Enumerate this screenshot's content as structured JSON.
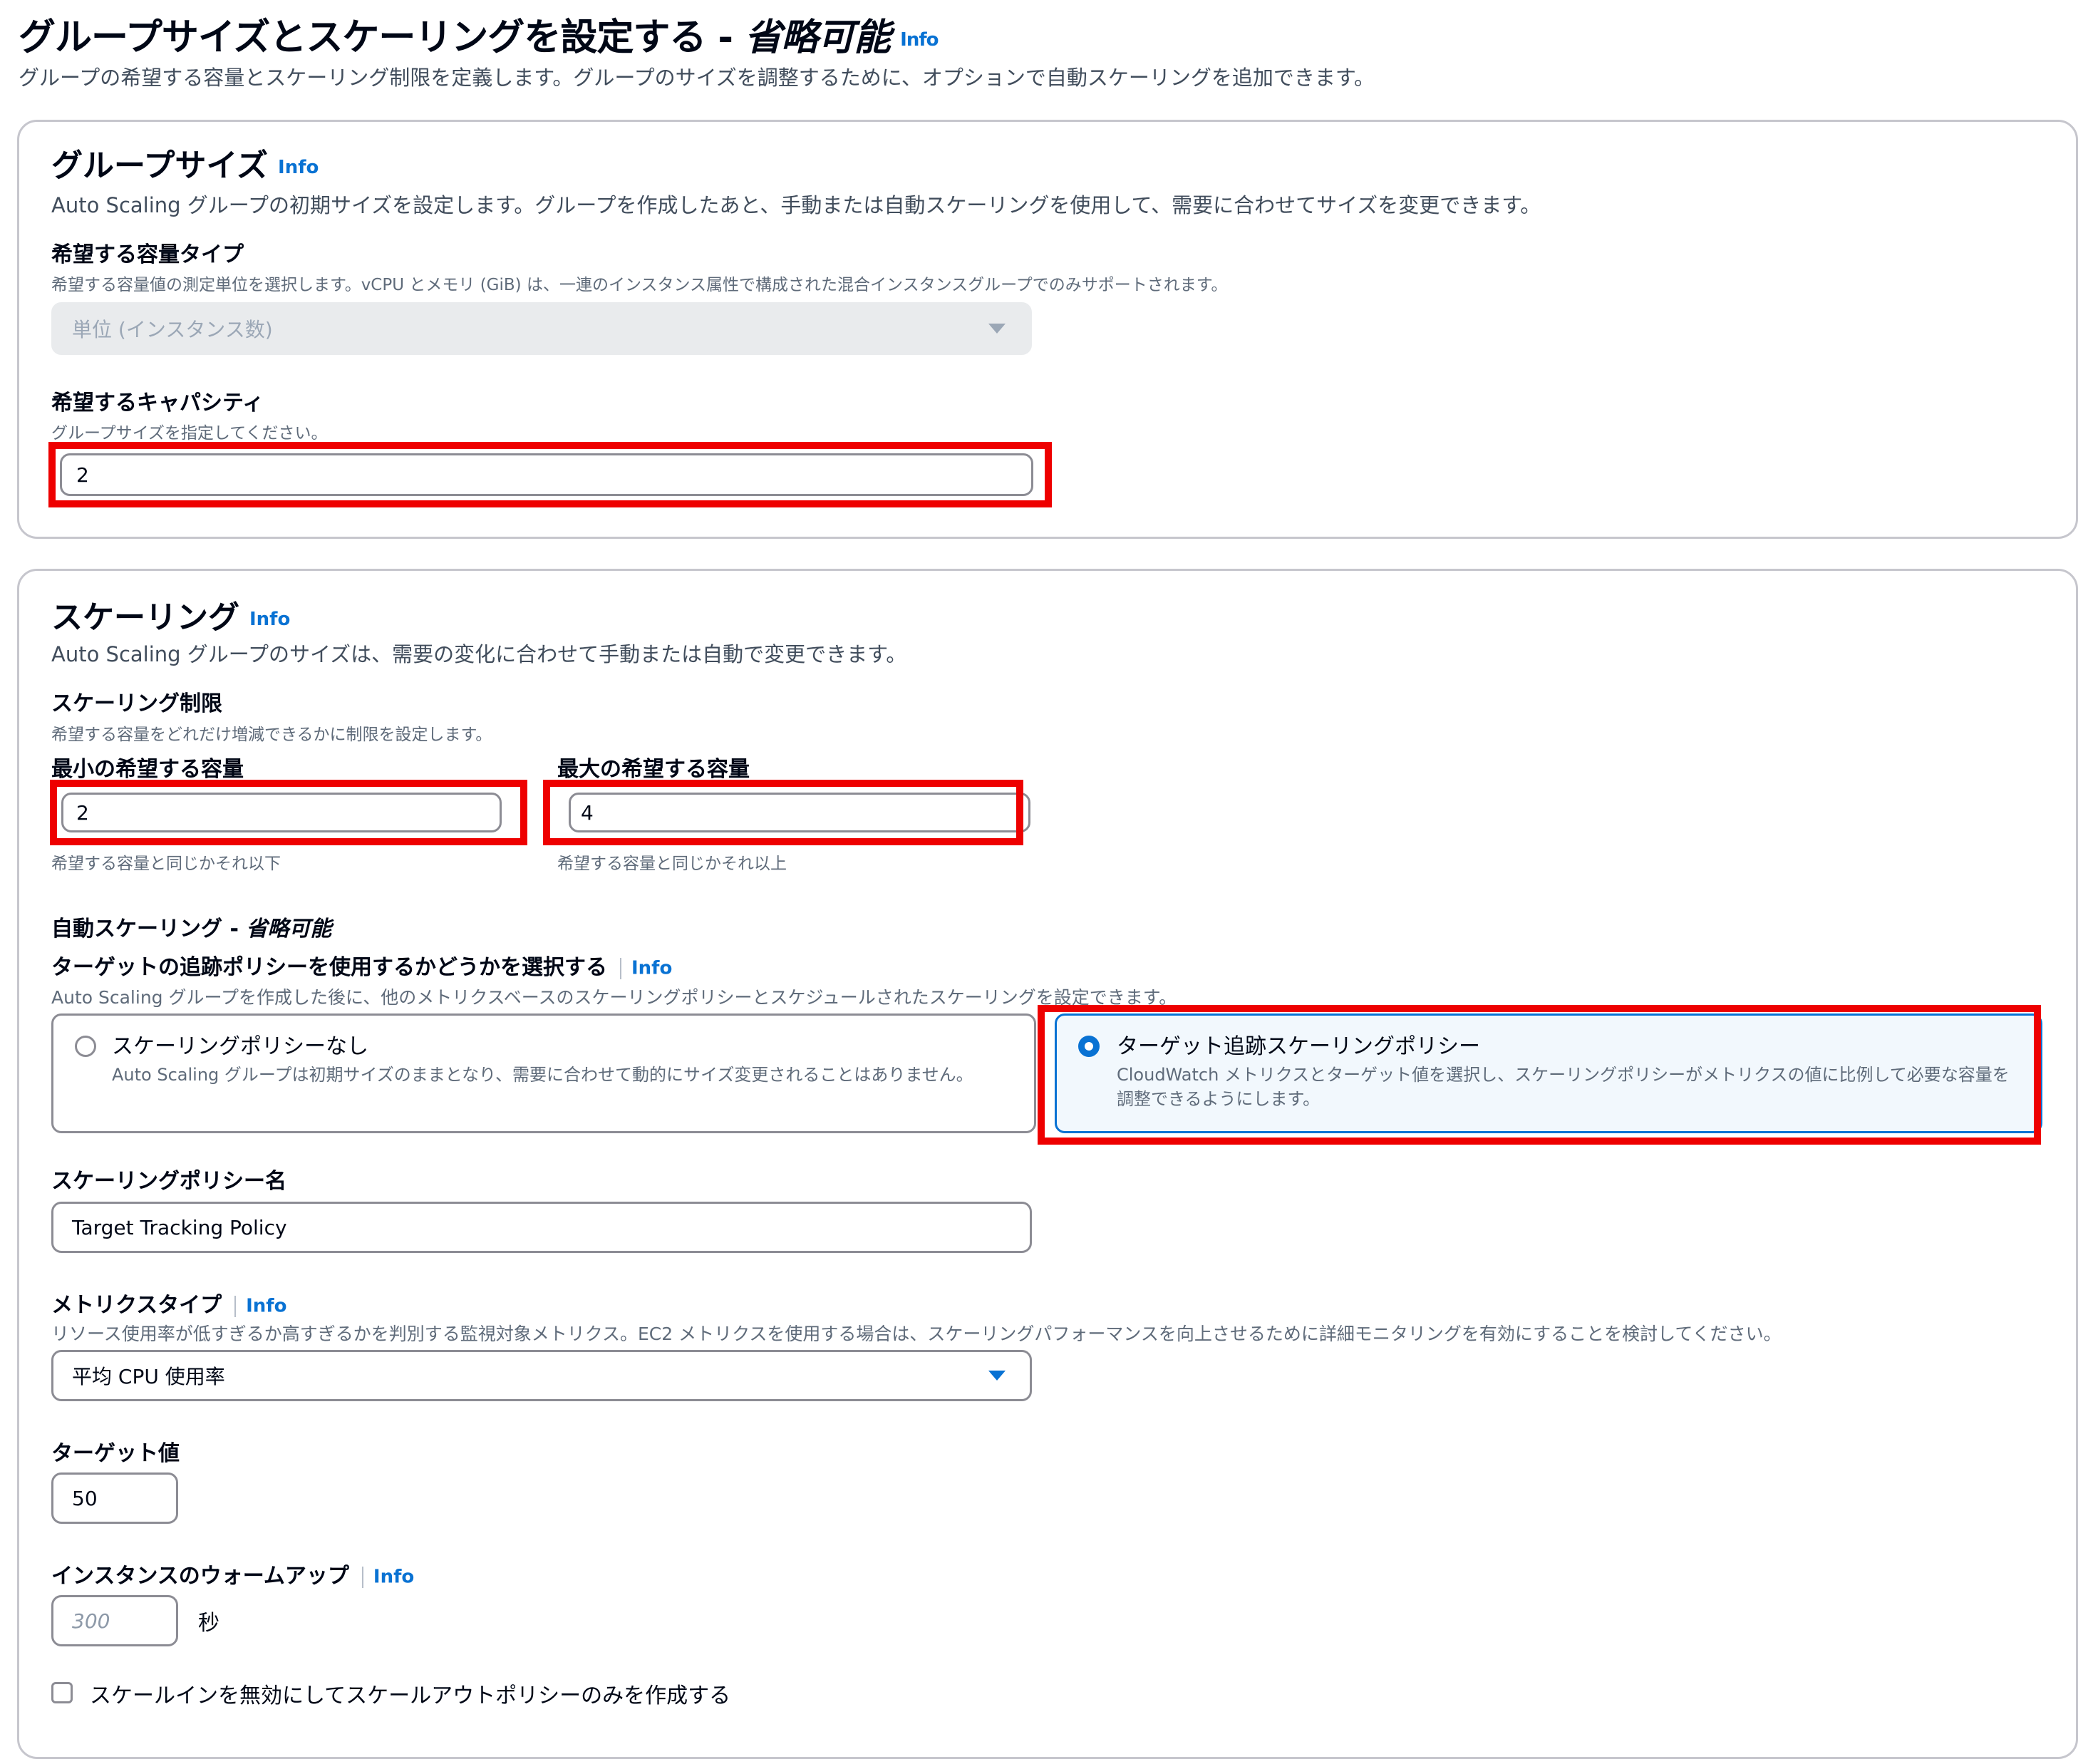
{
  "header": {
    "title": "グループサイズとスケーリングを設定する - ",
    "title_optional": "省略可能",
    "info": "Info",
    "description": "グループの希望する容量とスケーリング制限を定義します。グループのサイズを調整するために、オプションで自動スケーリングを追加できます。"
  },
  "group_size": {
    "heading": "グループサイズ",
    "info": "Info",
    "description": "Auto Scaling グループの初期サイズを設定します。グループを作成したあと、手動または自動スケーリングを使用して、需要に合わせてサイズを変更できます。",
    "capacity_type": {
      "label": "希望する容量タイプ",
      "description": "希望する容量値の測定単位を選択します。vCPU とメモリ (GiB) は、一連のインスタンス属性で構成された混合インスタンスグループでのみサポートされます。",
      "value": "単位 (インスタンス数)"
    },
    "desired_capacity": {
      "label": "希望するキャパシティ",
      "description": "グループサイズを指定してください。",
      "value": "2"
    }
  },
  "scaling": {
    "heading": "スケーリング",
    "info": "Info",
    "description": "Auto Scaling グループのサイズは、需要の変化に合わせて手動または自動で変更できます。",
    "limits": {
      "label": "スケーリング制限",
      "description": "希望する容量をどれだけ増減できるかに制限を設定します。",
      "min": {
        "label": "最小の希望する容量",
        "value": "2",
        "hint": "希望する容量と同じかそれ以下"
      },
      "max": {
        "label": "最大の希望する容量",
        "value": "4",
        "hint": "希望する容量と同じかそれ以上"
      }
    },
    "auto": {
      "label": "自動スケーリング - ",
      "label_optional": "省略可能",
      "question": "ターゲットの追跡ポリシーを使用するかどうかを選択する",
      "info": "Info",
      "description": "Auto Scaling グループを作成した後に、他のメトリクスベースのスケーリングポリシーとスケジュールされたスケーリングを設定できます。",
      "options": [
        {
          "title": "スケーリングポリシーなし",
          "description": "Auto Scaling グループは初期サイズのままとなり、需要に合わせて動的にサイズ変更されることはありません。",
          "selected": false
        },
        {
          "title": "ターゲット追跡スケーリングポリシー",
          "description": "CloudWatch メトリクスとターゲット値を選択し、スケーリングポリシーがメトリクスの値に比例して必要な容量を調整できるようにします。",
          "selected": true
        }
      ]
    },
    "policy_name": {
      "label": "スケーリングポリシー名",
      "value": "Target Tracking Policy"
    },
    "metric_type": {
      "label": "メトリクスタイプ",
      "info": "Info",
      "description": "リソース使用率が低すぎるか高すぎるかを判別する監視対象メトリクス。EC2 メトリクスを使用する場合は、スケーリングパフォーマンスを向上させるために詳細モニタリングを有効にすることを検討してください。",
      "value": "平均 CPU 使用率"
    },
    "target_value": {
      "label": "ターゲット値",
      "value": "50"
    },
    "warmup": {
      "label": "インスタンスのウォームアップ",
      "info": "Info",
      "placeholder": "300",
      "unit": "秒"
    },
    "disable_scale_in": {
      "label": "スケールインを無効にしてスケールアウトポリシーのみを作成する",
      "checked": false
    }
  },
  "colors": {
    "link": "#0972d3",
    "highlight": "#ee0000",
    "border": "#8c8c94"
  }
}
